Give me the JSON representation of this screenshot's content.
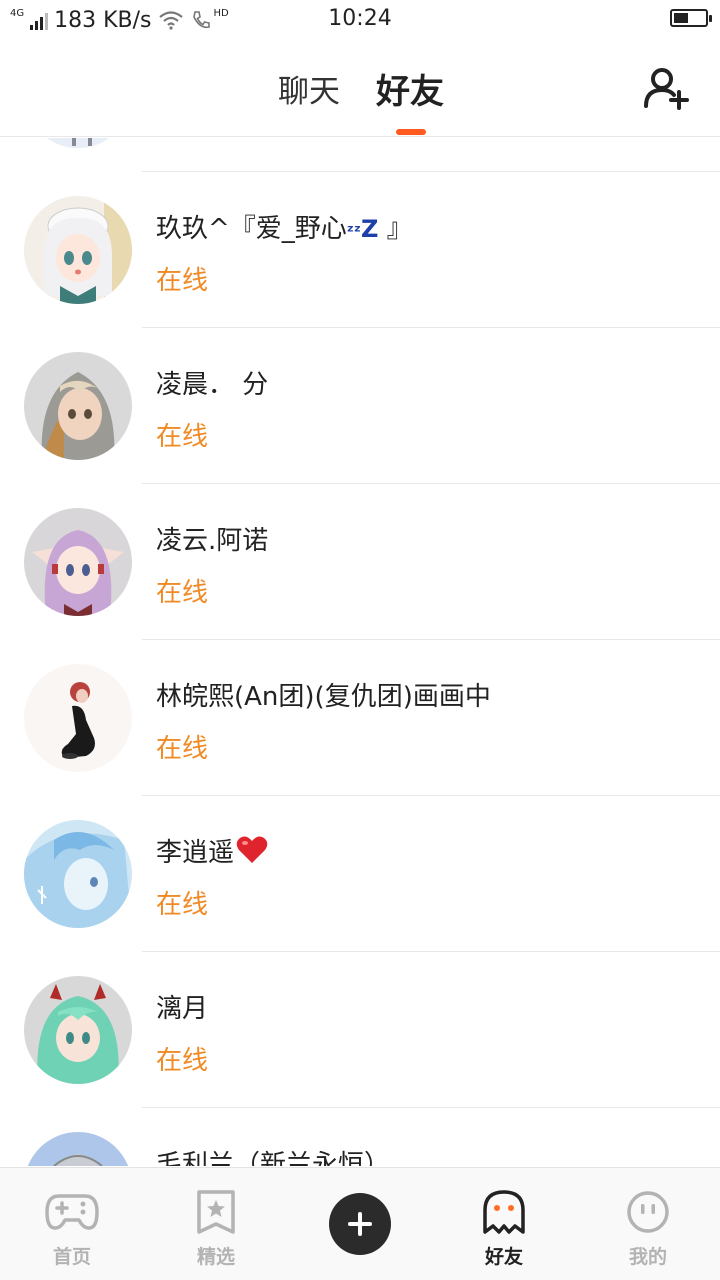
{
  "status_bar": {
    "network": "4G",
    "speed": "183 KB/s",
    "hd": "HD",
    "time": "10:24",
    "battery_level": 0.45
  },
  "header": {
    "tabs": [
      {
        "label": "聊天",
        "active": false
      },
      {
        "label": "好友",
        "active": true
      }
    ],
    "add_friend_icon": "add-person-icon",
    "accent_color": "#ff5a1f"
  },
  "friends": [
    {
      "name": "玖玖^『爱_野心",
      "name_suffix": "zzZ』",
      "status": "在线",
      "avatar": "avatar-anime-white-hair"
    },
    {
      "name": "凌晨．  分",
      "status": "在线",
      "avatar": "avatar-anime-gray-hair"
    },
    {
      "name": "凌云.阿诺",
      "status": "在线",
      "avatar": "avatar-anime-pink-hair"
    },
    {
      "name": "林皖熙(An团)(复仇团)画画中",
      "status": "在线",
      "avatar": "avatar-anime-red-hair-sitting"
    },
    {
      "name": "李逍遥",
      "status": "在线",
      "avatar": "avatar-anime-blue-hair",
      "emoji": "heart"
    },
    {
      "name": "漓月",
      "status": "在线",
      "avatar": "avatar-anime-green-hair"
    },
    {
      "name": "毛利兰（新兰永恒）",
      "status": "",
      "avatar": "avatar-anime-partial"
    }
  ],
  "status_color": "#f08a24",
  "bottom_nav": {
    "items": [
      {
        "label": "首页",
        "icon": "gamepad-icon",
        "active": false
      },
      {
        "label": "精选",
        "icon": "star-bookmark-icon",
        "active": false
      },
      {
        "label": "",
        "icon": "plus-icon",
        "active": false
      },
      {
        "label": "好友",
        "icon": "ghost-icon",
        "active": true
      },
      {
        "label": "我的",
        "icon": "face-icon",
        "active": false
      }
    ]
  }
}
